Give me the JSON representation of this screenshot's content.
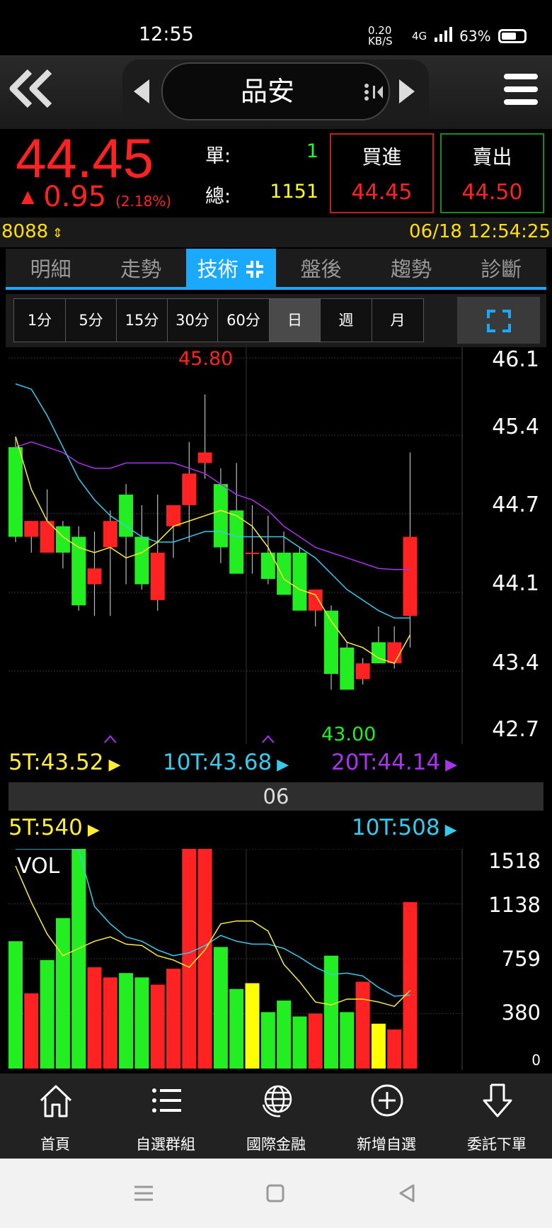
{
  "status_bar": {
    "time": "12:55",
    "net_speed": "0.20 KB/S",
    "network": "4G",
    "battery": "63%"
  },
  "header": {
    "stock_name": "品安"
  },
  "quote": {
    "price": "44.45",
    "change": "0.95",
    "change_pct": "(2.18%)",
    "single_label": "單:",
    "single_value": "1",
    "total_label": "總:",
    "total_value": "1151",
    "buy_label": "買進",
    "buy_price": "44.45",
    "sell_label": "賣出",
    "sell_price": "44.50"
  },
  "info": {
    "code": "8088",
    "datetime": "06/18 12:54:25"
  },
  "tabs": [
    "明細",
    "走勢",
    "技術",
    "盤後",
    "趨勢",
    "診斷"
  ],
  "active_tab": "技術",
  "periods": [
    "1分",
    "5分",
    "15分",
    "30分",
    "60分",
    "日",
    "週",
    "月"
  ],
  "active_period": "日",
  "colors": {
    "up": "#ff2222",
    "down": "#22ee22",
    "ma5": "#ffee33",
    "ma10": "#33ccee",
    "ma20": "#aa33ee",
    "accent": "#19aaff"
  },
  "chart_data": [
    {
      "type": "candlestick",
      "ylim": [
        42.7,
        46.1
      ],
      "y_ticks": [
        "46.1",
        "45.4",
        "44.7",
        "44.1",
        "43.4",
        "42.7"
      ],
      "high_label": "45.80",
      "low_label": "43.00",
      "x_label": "06",
      "ma_labels": {
        "ma5": "5T:43.52",
        "ma10": "10T:43.68",
        "ma20": "20T:44.14"
      },
      "candles": [
        {
          "o": 45.3,
          "h": 45.4,
          "l": 44.4,
          "c": 44.45
        },
        {
          "o": 44.45,
          "h": 44.6,
          "l": 44.3,
          "c": 44.6
        },
        {
          "o": 44.3,
          "h": 44.9,
          "l": 44.3,
          "c": 44.6
        },
        {
          "o": 44.55,
          "h": 44.6,
          "l": 44.15,
          "c": 44.3
        },
        {
          "o": 44.45,
          "h": 44.55,
          "l": 43.75,
          "c": 43.8
        },
        {
          "o": 44.0,
          "h": 44.5,
          "l": 43.7,
          "c": 44.15
        },
        {
          "o": 44.35,
          "h": 44.7,
          "l": 43.7,
          "c": 44.6
        },
        {
          "o": 44.85,
          "h": 44.95,
          "l": 44.0,
          "c": 44.45
        },
        {
          "o": 44.45,
          "h": 44.75,
          "l": 43.95,
          "c": 44.0
        },
        {
          "o": 43.85,
          "h": 44.85,
          "l": 43.75,
          "c": 44.3
        },
        {
          "o": 44.55,
          "h": 44.65,
          "l": 44.25,
          "c": 44.75
        },
        {
          "o": 44.75,
          "h": 45.35,
          "l": 44.4,
          "c": 45.05
        },
        {
          "o": 45.15,
          "h": 45.8,
          "l": 45.0,
          "c": 45.25
        },
        {
          "o": 44.95,
          "h": 45.1,
          "l": 44.2,
          "c": 44.35
        },
        {
          "o": 44.7,
          "h": 45.15,
          "l": 44.3,
          "c": 44.1
        },
        {
          "o": 44.3,
          "h": 44.75,
          "l": 44.1,
          "c": 44.3
        },
        {
          "o": 44.3,
          "h": 44.65,
          "l": 44.0,
          "c": 44.05
        },
        {
          "o": 44.3,
          "h": 44.5,
          "l": 43.95,
          "c": 43.9
        },
        {
          "o": 44.3,
          "h": 44.35,
          "l": 43.75,
          "c": 43.75
        },
        {
          "o": 43.75,
          "h": 43.95,
          "l": 43.6,
          "c": 43.95
        },
        {
          "o": 43.75,
          "h": 43.8,
          "l": 43.0,
          "c": 43.15
        },
        {
          "o": 43.4,
          "h": 43.45,
          "l": 43.05,
          "c": 43.0
        },
        {
          "o": 43.1,
          "h": 43.3,
          "l": 43.05,
          "c": 43.25
        },
        {
          "o": 43.45,
          "h": 43.6,
          "l": 43.3,
          "c": 43.25
        },
        {
          "o": 43.25,
          "h": 43.6,
          "l": 43.2,
          "c": 43.45
        },
        {
          "o": 43.7,
          "h": 45.25,
          "l": 43.4,
          "c": 44.45
        }
      ],
      "ma5": [
        45.4,
        44.9,
        44.6,
        44.45,
        44.35,
        44.3,
        44.35,
        44.25,
        44.3,
        44.4,
        44.55,
        44.6,
        44.65,
        44.7,
        44.65,
        44.55,
        44.35,
        44.05,
        43.95,
        43.9,
        43.65,
        43.45,
        43.4,
        43.3,
        43.25,
        43.52
      ],
      "ma10": [
        45.9,
        45.85,
        45.6,
        45.3,
        45.0,
        44.8,
        44.65,
        44.55,
        44.45,
        44.4,
        44.4,
        44.45,
        44.5,
        44.5,
        44.45,
        44.45,
        44.45,
        44.45,
        44.35,
        44.25,
        44.1,
        43.95,
        43.85,
        43.75,
        43.68,
        43.68
      ],
      "ma20": [
        45.3,
        45.35,
        45.3,
        45.25,
        45.15,
        45.1,
        45.1,
        45.15,
        45.15,
        45.15,
        45.15,
        45.1,
        45.05,
        44.95,
        44.85,
        44.8,
        44.7,
        44.55,
        44.45,
        44.35,
        44.3,
        44.25,
        44.2,
        44.15,
        44.14,
        44.14
      ],
      "down_markers": [
        6,
        16
      ]
    },
    {
      "type": "bar",
      "title": "VOL",
      "ylim": [
        0,
        1518
      ],
      "y_ticks": [
        "1518",
        "1138",
        "759",
        "380",
        "0"
      ],
      "ma_labels": {
        "ma5": "5T:540",
        "ma10": "10T:508"
      },
      "values": [
        880,
        520,
        750,
        1040,
        1518,
        700,
        630,
        660,
        630,
        580,
        690,
        1518,
        1518,
        840,
        550,
        590,
        390,
        470,
        360,
        380,
        780,
        390,
        600,
        310,
        270,
        1150
      ],
      "bar_colors": [
        "g",
        "r",
        "g",
        "g",
        "g",
        "r",
        "r",
        "g",
        "g",
        "r",
        "r",
        "r",
        "r",
        "g",
        "g",
        "y",
        "g",
        "g",
        "g",
        "r",
        "g",
        "g",
        "r",
        "y",
        "r",
        "r"
      ],
      "ma5": [
        1400,
        1150,
        930,
        780,
        830,
        880,
        910,
        860,
        850,
        780,
        750,
        700,
        820,
        1000,
        1020,
        1020,
        950,
        720,
        600,
        460,
        440,
        480,
        480,
        460,
        430,
        540
      ],
      "ma10": [
        1518,
        1518,
        1518,
        1518,
        1518,
        1120,
        1000,
        910,
        880,
        820,
        780,
        800,
        850,
        920,
        880,
        860,
        860,
        830,
        770,
        700,
        650,
        660,
        640,
        560,
        500,
        508
      ]
    }
  ],
  "bottom_nav": [
    "首頁",
    "自選群組",
    "國際金融",
    "新增自選",
    "委託下單"
  ]
}
